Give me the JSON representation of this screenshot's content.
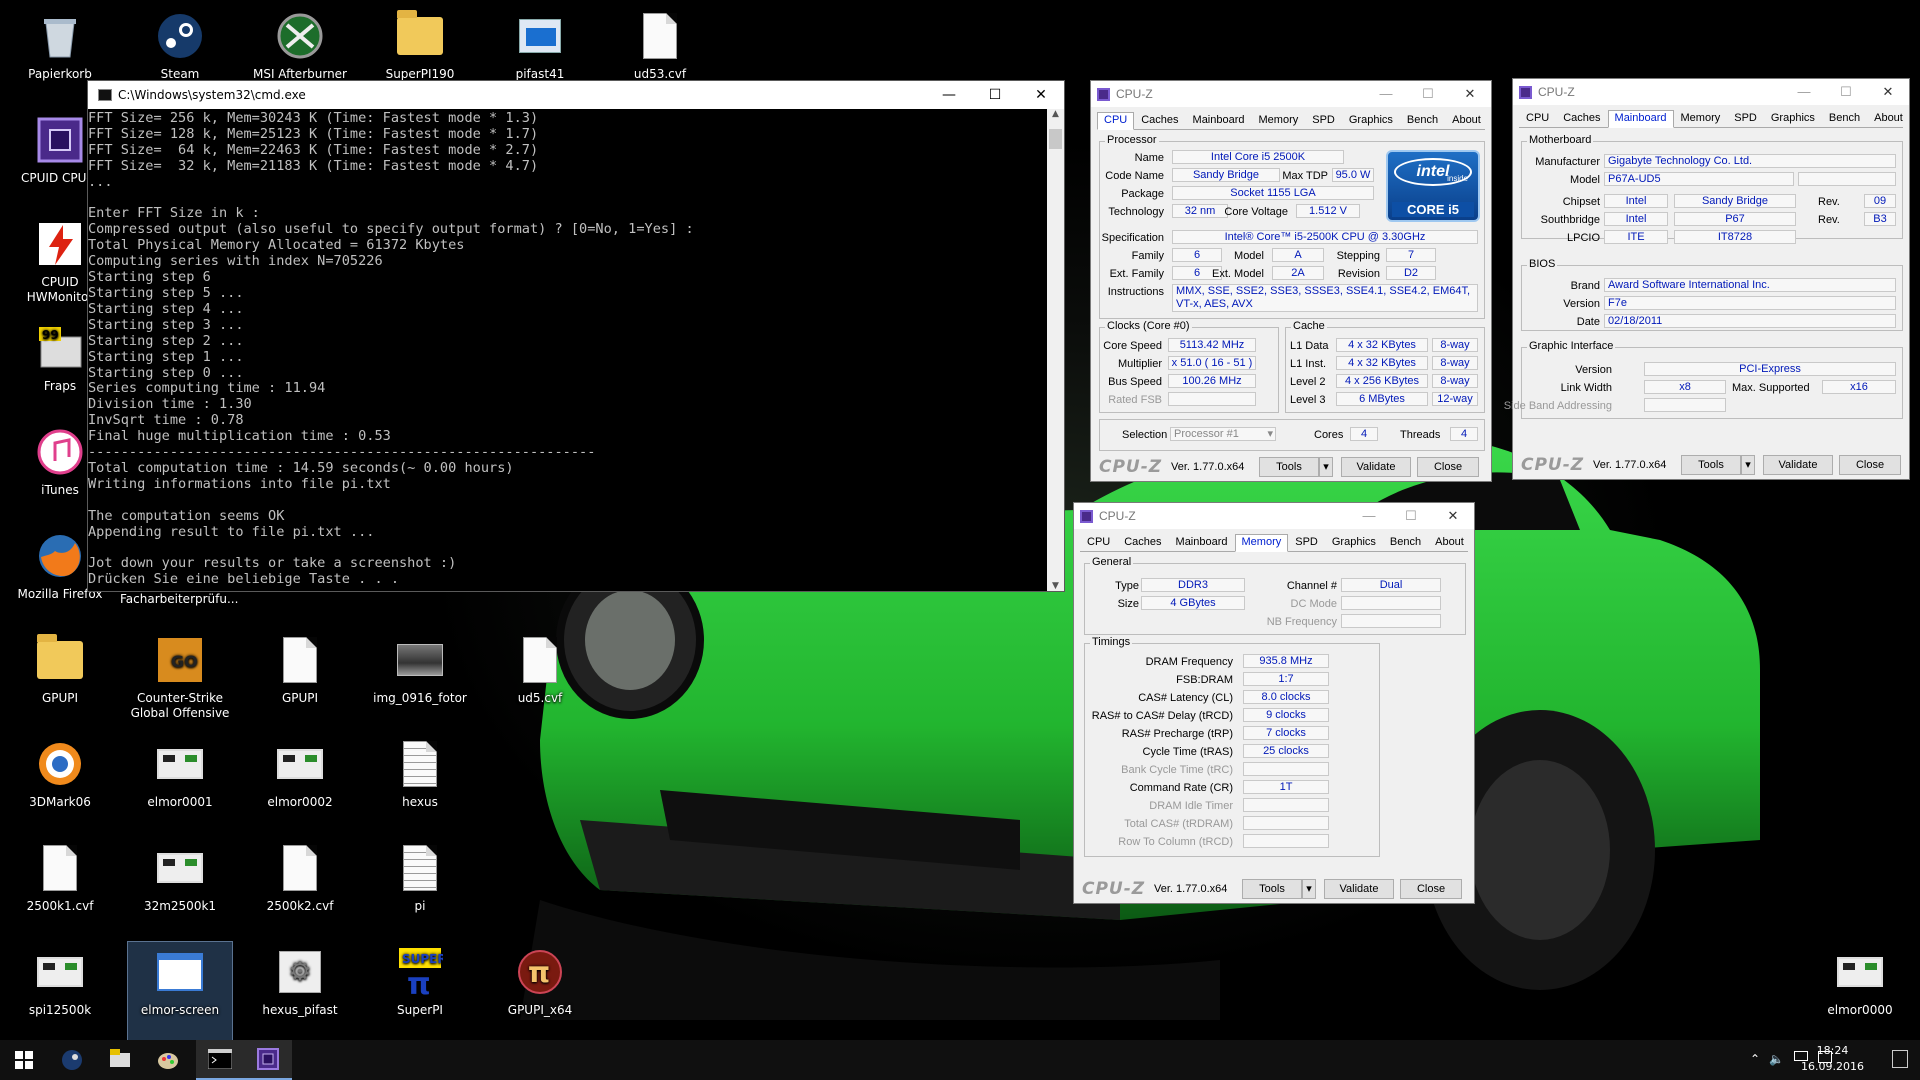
{
  "desktop_icons": [
    {
      "label": "Papierkorb",
      "icon": "recycle-bin-icon"
    },
    {
      "label": "Steam",
      "icon": "steam-icon"
    },
    {
      "label": "MSI Afterburner",
      "icon": "msi-afterburner-icon"
    },
    {
      "label": "SuperPI190",
      "icon": "folder-icon"
    },
    {
      "label": "pifast41",
      "icon": "app-icon"
    },
    {
      "label": "ud53.cvf",
      "icon": "file-icon"
    },
    {
      "label": "CPUID CPU-Z",
      "icon": "cpuz-icon"
    },
    {
      "label": "CPUID HWMonitor",
      "icon": "hwmonitor-icon"
    },
    {
      "label": "Fraps",
      "icon": "fraps-icon"
    },
    {
      "label": "iTunes",
      "icon": "itunes-icon"
    },
    {
      "label": "Mozilla Firefox",
      "icon": "firefox-icon"
    },
    {
      "label": "GPUPI",
      "icon": "folder-icon"
    },
    {
      "label": "Counter-Strike Global Offensive",
      "icon": "csgo-icon"
    },
    {
      "label": "GPUPI",
      "icon": "file-icon"
    },
    {
      "label": "img_0916_fotor",
      "icon": "image-icon"
    },
    {
      "label": "ud5.cvf",
      "icon": "file-icon"
    },
    {
      "label": "3DMark06",
      "icon": "3dmark-icon"
    },
    {
      "label": "elmor0001",
      "icon": "screenshot-icon"
    },
    {
      "label": "elmor0002",
      "icon": "screenshot-icon"
    },
    {
      "label": "hexus",
      "icon": "text-file-icon"
    },
    {
      "label": "2500k1.cvf",
      "icon": "file-icon"
    },
    {
      "label": "32m2500k1",
      "icon": "screenshot-icon"
    },
    {
      "label": "2500k2.cvf",
      "icon": "file-icon"
    },
    {
      "label": "pi",
      "icon": "text-file-icon"
    },
    {
      "label": "spi12500k",
      "icon": "screenshot-icon"
    },
    {
      "label": "elmor-screen",
      "icon": "window-icon"
    },
    {
      "label": "hexus_pifast",
      "icon": "gear-icon"
    },
    {
      "label": "SuperPI",
      "icon": "superpi-icon"
    },
    {
      "label": "GPUPI_x64",
      "icon": "gpupi-icon"
    },
    {
      "label": "elmor0000",
      "icon": "screenshot-icon"
    }
  ],
  "desktop_text_fragment": "Facharbeiterprüfu...",
  "cmd": {
    "title": "C:\\Windows\\system32\\cmd.exe",
    "lines": [
      "FFT Size= 256 k, Mem=30243 K (Time: Fastest mode * 1.3)",
      "FFT Size= 128 k, Mem=25123 K (Time: Fastest mode * 1.7)",
      "FFT Size=  64 k, Mem=22463 K (Time: Fastest mode * 2.7)",
      "FFT Size=  32 k, Mem=21183 K (Time: Fastest mode * 4.7)",
      "...",
      "",
      "Enter FFT Size in k :",
      "Compressed output (also useful to specify output format) ? [0=No, 1=Yes] :",
      "Total Physical Memory Allocated = 61372 Kbytes",
      "Computing series with index N=705226",
      "Starting step 6",
      "Starting step 5 ...",
      "Starting step 4 ...",
      "Starting step 3 ...",
      "Starting step 2 ...",
      "Starting step 1 ...",
      "Starting step 0 ...",
      "Series computing time : 11.94",
      "Division time : 1.30",
      "InvSqrt time : 0.78",
      "Final huge multiplication time : 0.53",
      "--------------------------------------------------------------",
      "Total computation time : 14.59 seconds(~ 0.00 hours)",
      "Writing informations into file pi.txt",
      "",
      "The computation seems OK",
      "Appending result to file pi.txt ...",
      "",
      "Jot down your results or take a screenshot :)",
      "Drücken Sie eine beliebige Taste . . ."
    ]
  },
  "cpuz_common": {
    "title": "CPU-Z",
    "tabs": [
      "CPU",
      "Caches",
      "Mainboard",
      "Memory",
      "SPD",
      "Graphics",
      "Bench",
      "About"
    ],
    "logo": "CPU-Z",
    "version": "Ver. 1.77.0.x64",
    "tools": "Tools",
    "validate": "Validate",
    "close": "Close"
  },
  "cpu": {
    "processor_group": "Processor",
    "name_l": "Name",
    "name": "Intel Core i5 2500K",
    "code_l": "Code Name",
    "code": "Sandy Bridge",
    "tdp_l": "Max TDP",
    "tdp": "95.0 W",
    "pkg_l": "Package",
    "pkg": "Socket 1155 LGA",
    "tech_l": "Technology",
    "tech": "32 nm",
    "volt_l": "Core Voltage",
    "volt": "1.512 V",
    "spec_l": "Specification",
    "spec": "Intel® Core™ i5-2500K CPU @ 3.30GHz",
    "fam_l": "Family",
    "fam": "6",
    "model_l": "Model",
    "model": "A",
    "step_l": "Stepping",
    "step": "7",
    "efam_l": "Ext. Family",
    "efam": "6",
    "emodel_l": "Ext. Model",
    "emodel": "2A",
    "rev_l": "Revision",
    "rev": "D2",
    "instr_l": "Instructions",
    "instr": "MMX, SSE, SSE2, SSE3, SSSE3, SSE4.1, SSE4.2, EM64T, VT-x, AES, AVX",
    "intel_badge": "intel",
    "intel_inside": "inside",
    "intel_core": "CORE i5",
    "clocks_group": "Clocks (Core #0)",
    "cs_l": "Core Speed",
    "cs": "5113.42 MHz",
    "mul_l": "Multiplier",
    "mul": "x 51.0 ( 16 - 51 )",
    "bus_l": "Bus Speed",
    "bus": "100.26 MHz",
    "fsb_l": "Rated FSB",
    "fsb": "",
    "cache_group": "Cache",
    "l1d_l": "L1 Data",
    "l1d": "4 x 32 KBytes",
    "l1d_w": "8-way",
    "l1i_l": "L1 Inst.",
    "l1i": "4 x 32 KBytes",
    "l1i_w": "8-way",
    "l2_l": "Level 2",
    "l2": "4 x 256 KBytes",
    "l2_w": "8-way",
    "l3_l": "Level 3",
    "l3": "6 MBytes",
    "l3_w": "12-way",
    "sel_l": "Selection",
    "sel": "Processor #1",
    "cores_l": "Cores",
    "cores": "4",
    "threads_l": "Threads",
    "threads": "4"
  },
  "mainboard": {
    "mb_group": "Motherboard",
    "manu_l": "Manufacturer",
    "manu": "Gigabyte Technology Co. Ltd.",
    "model_l": "Model",
    "model": "P67A-UD5",
    "chip_l": "Chipset",
    "chip_v": "Intel",
    "chip_n": "Sandy Bridge",
    "chip_rl": "Rev.",
    "chip_r": "09",
    "south_l": "Southbridge",
    "south_v": "Intel",
    "south_n": "P67",
    "south_rl": "Rev.",
    "south_r": "B3",
    "lpcio_l": "LPCIO",
    "lpcio_v": "ITE",
    "lpcio_n": "IT8728",
    "bios_group": "BIOS",
    "brand_l": "Brand",
    "brand": "Award Software International Inc.",
    "ver_l": "Version",
    "ver": "F7e",
    "date_l": "Date",
    "date": "02/18/2011",
    "gi_group": "Graphic Interface",
    "giver_l": "Version",
    "giver": "PCI-Express",
    "lw_l": "Link Width",
    "lw": "x8",
    "ms_l": "Max. Supported",
    "ms": "x16",
    "sba_l": "Side Band Addressing"
  },
  "memory": {
    "gen_group": "General",
    "type_l": "Type",
    "type": "DDR3",
    "size_l": "Size",
    "size": "4 GBytes",
    "chan_l": "Channel #",
    "chan": "Dual",
    "dc_l": "DC Mode",
    "nb_l": "NB Frequency",
    "tim_group": "Timings",
    "rows": [
      {
        "l": "DRAM Frequency",
        "v": "935.8 MHz",
        "dim": false
      },
      {
        "l": "FSB:DRAM",
        "v": "1:7",
        "dim": false
      },
      {
        "l": "CAS# Latency (CL)",
        "v": "8.0 clocks",
        "dim": false
      },
      {
        "l": "RAS# to CAS# Delay (tRCD)",
        "v": "9 clocks",
        "dim": false
      },
      {
        "l": "RAS# Precharge (tRP)",
        "v": "7 clocks",
        "dim": false
      },
      {
        "l": "Cycle Time (tRAS)",
        "v": "25 clocks",
        "dim": false
      },
      {
        "l": "Bank Cycle Time (tRC)",
        "v": "",
        "dim": true
      },
      {
        "l": "Command Rate (CR)",
        "v": "1T",
        "dim": false
      },
      {
        "l": "DRAM Idle Timer",
        "v": "",
        "dim": true
      },
      {
        "l": "Total CAS# (tRDRAM)",
        "v": "",
        "dim": true
      },
      {
        "l": "Row To Column (tRCD)",
        "v": "",
        "dim": true
      }
    ]
  },
  "taskbar": {
    "time": "18:24",
    "date": "16.09.2016",
    "apps": [
      "start-icon",
      "steam-icon",
      "fraps-icon",
      "paint-icon",
      "cmd-icon",
      "cpuz-icon"
    ]
  }
}
